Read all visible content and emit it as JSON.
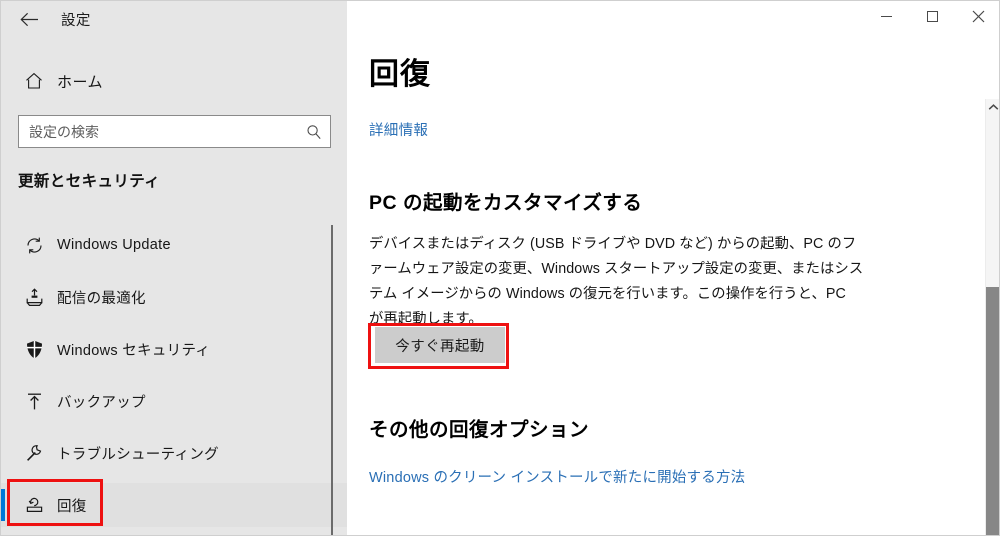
{
  "window": {
    "title": "設定",
    "back_icon": "back-arrow-icon",
    "controls": {
      "minimize": "minimize-icon",
      "maximize": "maximize-icon",
      "close": "close-icon"
    }
  },
  "sidebar": {
    "home_label": "ホーム",
    "home_icon": "home-icon",
    "search": {
      "placeholder": "設定の検索",
      "value": "",
      "icon": "search-icon"
    },
    "group_title": "更新とセキュリティ",
    "items": [
      {
        "label": "Windows Update",
        "icon": "sync-refresh-icon",
        "selected": false
      },
      {
        "label": "配信の最適化",
        "icon": "delivery-optimization-icon",
        "selected": false
      },
      {
        "label": "Windows セキュリティ",
        "icon": "shield-icon",
        "selected": false
      },
      {
        "label": "バックアップ",
        "icon": "backup-upload-icon",
        "selected": false
      },
      {
        "label": "トラブルシューティング",
        "icon": "wrench-icon",
        "selected": false
      },
      {
        "label": "回復",
        "icon": "recovery-icon",
        "selected": true
      }
    ]
  },
  "main": {
    "page_title": "回復",
    "more_info_link": "詳細情報",
    "sections": [
      {
        "heading": "PC の起動をカスタマイズする",
        "body": "デバイスまたはディスク (USB ドライブや DVD など) からの起動、PC のファームウェア設定の変更、Windows スタートアップ設定の変更、またはシステム イメージからの Windows の復元を行います。この操作を行うと、PC が再起動します。",
        "button": "今すぐ再起動"
      },
      {
        "heading": "その他の回復オプション",
        "link": "Windows のクリーン インストールで新たに開始する方法"
      }
    ]
  },
  "scrollbar": {
    "up_arrow_icon": "chevron-up-icon"
  },
  "annotations": [
    {
      "name": "restart-button-highlight",
      "color": "#ee1111"
    },
    {
      "name": "recovery-nav-highlight",
      "color": "#ee1111"
    }
  ],
  "colors": {
    "accent": "#0078d7",
    "link": "#2a6fb5",
    "sidebar_bg": "#e6e6e6",
    "annotation": "#ee1111",
    "button_bg": "#cccccc"
  }
}
